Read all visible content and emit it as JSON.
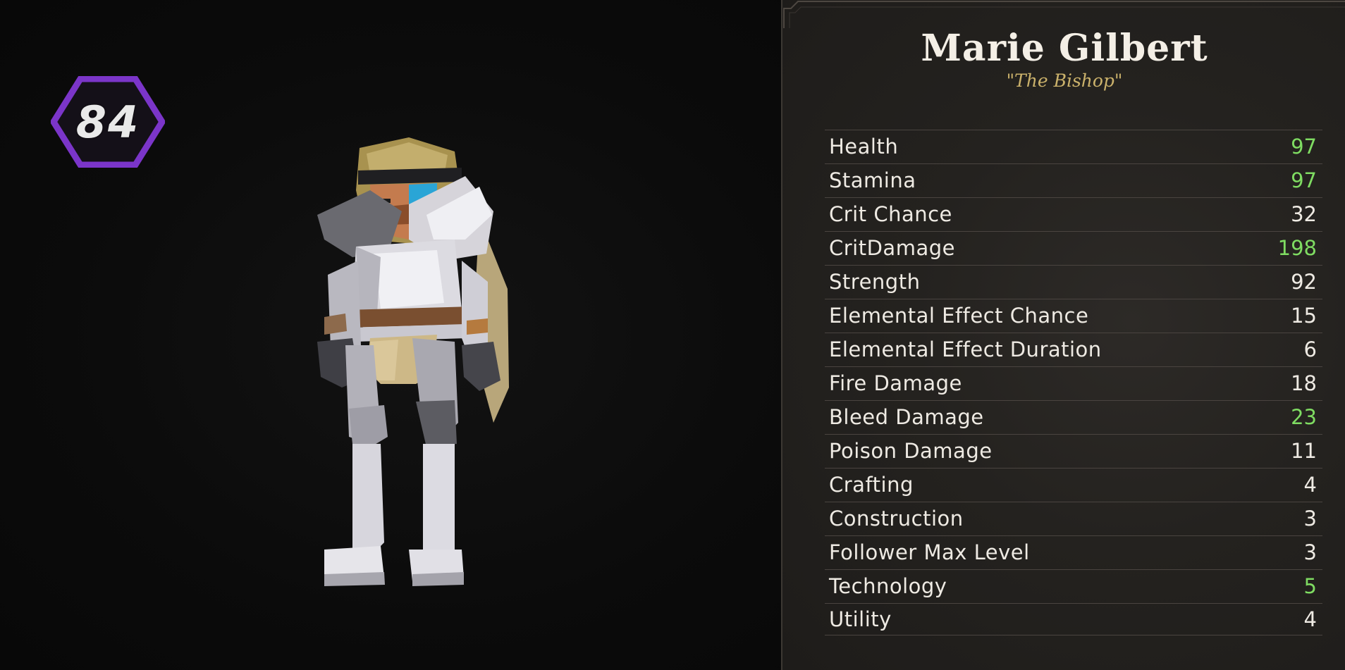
{
  "level": "84",
  "character": {
    "name": "Marie Gilbert",
    "title": "\"The Bishop\""
  },
  "colors": {
    "level_badge": "#7b35c9",
    "title": "#cbb26b",
    "boosted_value": "#7fdc62"
  },
  "stats": [
    {
      "label": "Health",
      "value": "97",
      "boosted": true
    },
    {
      "label": "Stamina",
      "value": "97",
      "boosted": true
    },
    {
      "label": "Crit Chance",
      "value": "32",
      "boosted": false
    },
    {
      "label": "CritDamage",
      "value": "198",
      "boosted": true
    },
    {
      "label": "Strength",
      "value": "92",
      "boosted": false
    },
    {
      "label": "Elemental Effect Chance",
      "value": "15",
      "boosted": false
    },
    {
      "label": "Elemental Effect Duration",
      "value": "6",
      "boosted": false
    },
    {
      "label": "Fire Damage",
      "value": "18",
      "boosted": false
    },
    {
      "label": "Bleed Damage",
      "value": "23",
      "boosted": true
    },
    {
      "label": "Poison Damage",
      "value": "11",
      "boosted": false
    },
    {
      "label": "Crafting",
      "value": "4",
      "boosted": false
    },
    {
      "label": "Construction",
      "value": "3",
      "boosted": false
    },
    {
      "label": "Follower Max Level",
      "value": "3",
      "boosted": false
    },
    {
      "label": "Technology",
      "value": "5",
      "boosted": true
    },
    {
      "label": "Utility",
      "value": "4",
      "boosted": false
    }
  ]
}
